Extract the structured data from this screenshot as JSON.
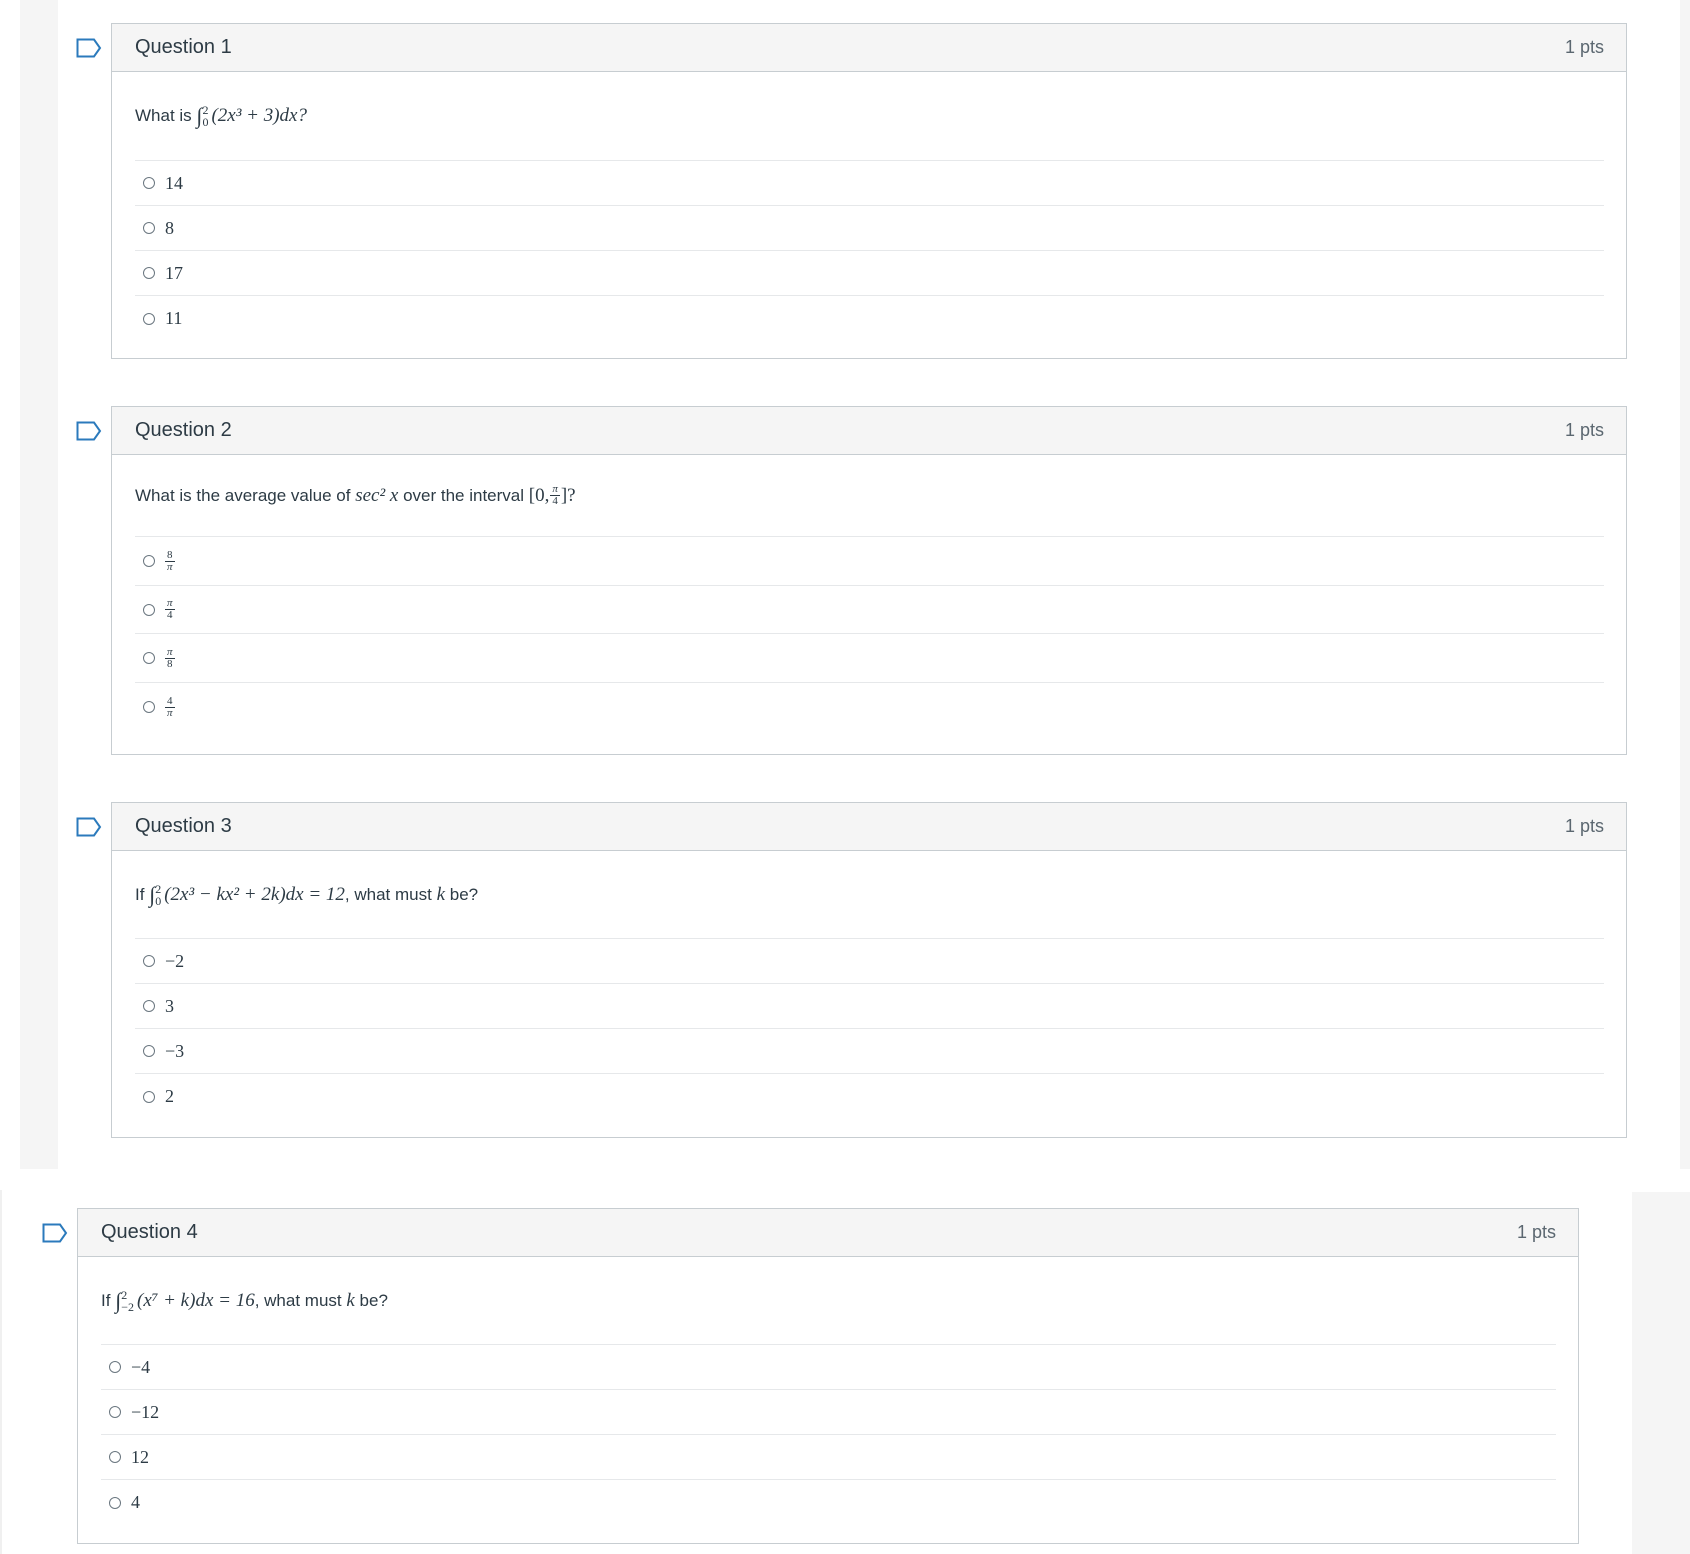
{
  "questions": [
    {
      "title": "Question 1",
      "points": "1 pts",
      "prompt_prefix": "What is",
      "integral_lower": "0",
      "integral_upper": "2",
      "integrand": "(2x³ + 3)dx",
      "prompt_suffix": "?",
      "answers": [
        "14",
        "8",
        "17",
        "11"
      ]
    },
    {
      "title": "Question 2",
      "points": "1 pts",
      "prompt_prefix": "What is the average value of",
      "function": "sec² x",
      "prompt_middle": "over the interval",
      "interval_open": "[0,",
      "interval_num": "π",
      "interval_den": "4",
      "interval_close": "]?",
      "answers": [
        {
          "num": "8",
          "den": "π"
        },
        {
          "num": "π",
          "den": "4"
        },
        {
          "num": "π",
          "den": "8"
        },
        {
          "num": "4",
          "den": "π"
        }
      ]
    },
    {
      "title": "Question 3",
      "points": "1 pts",
      "prompt_prefix": "If",
      "integral_lower": "0",
      "integral_upper": "2",
      "integrand": "(2x³ − kx² + 2k)dx = 12",
      "prompt_suffix_a": ", what must",
      "variable": "k",
      "prompt_suffix_b": "be?",
      "answers": [
        "−2",
        "3",
        "−3",
        "2"
      ]
    },
    {
      "title": "Question 4",
      "points": "1 pts",
      "prompt_prefix": "If",
      "integral_lower": "−2",
      "integral_upper": "2",
      "integrand": "(x⁷ + k)dx = 16",
      "prompt_suffix_a": ", what must",
      "variable": "k",
      "prompt_suffix_b": "be?",
      "answers": [
        "−4",
        "−12",
        "12",
        "4"
      ]
    }
  ]
}
